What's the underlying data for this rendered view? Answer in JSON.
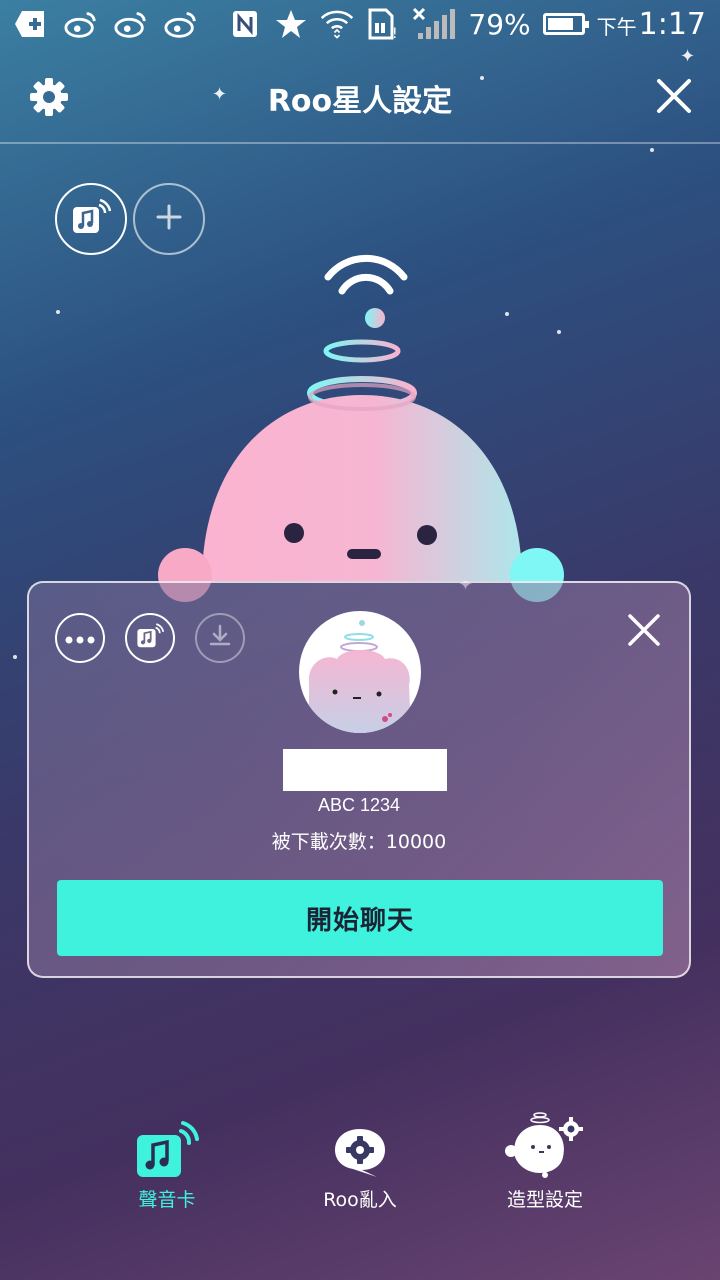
{
  "status_bar": {
    "battery_percent": "79%",
    "battery_level": 0.79,
    "time_prefix": "下午",
    "time": "1:17",
    "icons": [
      "add-app-icon",
      "weibo-icon",
      "weibo-icon",
      "weibo-icon",
      "nfc-icon",
      "star-icon",
      "wifi-icon",
      "sim-card-icon",
      "no-signal-icon",
      "cell-signal-icon",
      "battery-icon"
    ]
  },
  "header": {
    "title": "Roo星人設定",
    "settings_icon": "gear-icon",
    "close_icon": "close-icon"
  },
  "top_actions": [
    {
      "name": "voice-card-toggle",
      "icon": "music-wave-icon",
      "active": true
    },
    {
      "name": "add-button",
      "icon": "plus-icon",
      "active": false
    }
  ],
  "card": {
    "more_icon": "more-dots-icon",
    "voice_icon": "music-wave-icon",
    "download_icon": "download-icon",
    "close_icon": "close-icon",
    "name": "",
    "user_id": "ABC 1234",
    "downloads_text": "被下載次數：10000",
    "start_button_label": "開始聊天"
  },
  "bottom_nav": [
    {
      "label": "聲音卡",
      "icon": "music-wave-icon",
      "active": true
    },
    {
      "label": "Roo亂入",
      "icon": "gear-bubble-icon",
      "active": false
    },
    {
      "label": "造型設定",
      "icon": "character-settings-icon",
      "active": false
    }
  ],
  "colors": {
    "accent": "#3ff2dd",
    "creature_pink": "#f9b3cf",
    "creature_cyan": "#7ff7f4"
  }
}
